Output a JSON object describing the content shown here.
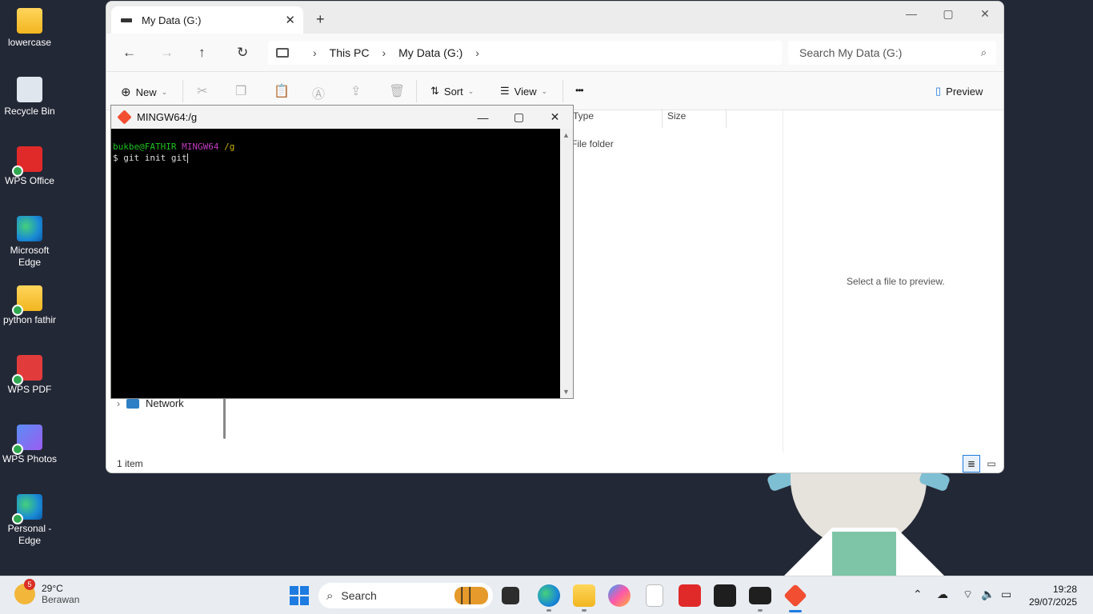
{
  "desktop": {
    "icons": [
      {
        "label": "lowercase"
      },
      {
        "label": "Recycle Bin"
      },
      {
        "label": "WPS Office"
      },
      {
        "label": "Microsoft Edge"
      },
      {
        "label": "python fathir"
      },
      {
        "label": "WPS PDF"
      },
      {
        "label": "WPS Photos"
      },
      {
        "label": "Personal - Edge"
      }
    ]
  },
  "explorer": {
    "tab_title": "My Data (G:)",
    "tab_close": "✕",
    "new_tab": "+",
    "breadcrumb": [
      "This PC",
      "My Data (G:)"
    ],
    "search_placeholder": "Search My Data (G:)",
    "commands": {
      "new": "New",
      "sort": "Sort",
      "view": "View",
      "more": "•••",
      "preview": "Preview"
    },
    "columns": {
      "type": "Type",
      "size": "Size"
    },
    "row_type": "File folder",
    "preview_text": "Select a file to preview.",
    "nav_item": "Network",
    "status": "1 item"
  },
  "terminal": {
    "title": "MINGW64:/g",
    "prompt_user": "bukbe@FATHIR",
    "prompt_env": "MINGW64",
    "prompt_path": "/g",
    "command_line": "$ git init git"
  },
  "taskbar": {
    "weather_temp": "29°C",
    "weather_desc": "Berawan",
    "weather_badge": "5",
    "search_label": "Search",
    "time": "19:28",
    "date": "29/07/2025"
  },
  "colors": {
    "desktop_bg": "#232836",
    "accent": "#1e7be0",
    "prompt_green": "#1fc21f",
    "prompt_magenta": "#c03cc0",
    "prompt_yellow": "#c8b400"
  }
}
